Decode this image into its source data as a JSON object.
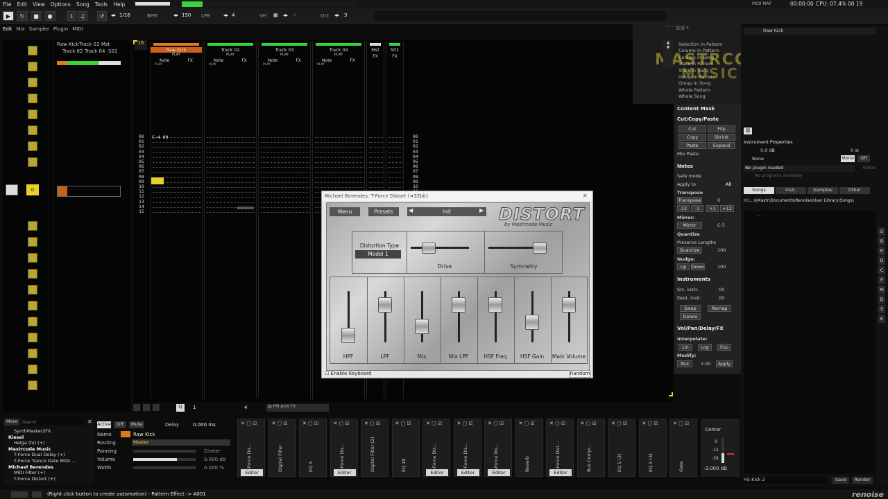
{
  "menu": [
    "File",
    "Edit",
    "View",
    "Options",
    "Song",
    "Tools",
    "Help"
  ],
  "topbar": {
    "midi_map": "MIDI MAP",
    "time": "00:00:00",
    "cpu": "CPU: 07.4%",
    "clock": "00 19"
  },
  "transport": {
    "step": "1/16",
    "bpm_label": "BPM",
    "bpm": "150",
    "lpb_label": "LPB",
    "lpb": "4",
    "vel_label": "Vel",
    "vel": "--",
    "oct_label": "Oct",
    "oct": "3"
  },
  "view_tabs": [
    "Edit",
    "Mix",
    "Sampler",
    "Plugin",
    "MIDI"
  ],
  "pattern_seq": {
    "current": "16"
  },
  "matrix_tracks": [
    "Raw Kick",
    "Track 03",
    "Mst",
    "Track 02",
    "Track 04",
    "S01"
  ],
  "tracks": [
    {
      "name": "Raw Kick",
      "play": "PLAY",
      "cols": [
        "Note",
        "FX"
      ],
      "sub": "PLAY"
    },
    {
      "name": "Track 02",
      "play": "PLAY",
      "cols": [
        "Note",
        "FX"
      ],
      "sub": "PLAY"
    },
    {
      "name": "Track 03",
      "play": "PLAY",
      "cols": [
        "Note",
        "FX"
      ],
      "sub": "PLAY"
    },
    {
      "name": "Track 04",
      "play": "PLAY",
      "cols": [
        "Note",
        "FX"
      ],
      "sub": "PLAY"
    },
    {
      "name": "Mst",
      "play": "",
      "cols": [
        "FX"
      ],
      "sub": ""
    },
    {
      "name": "S01",
      "play": "",
      "cols": [
        "FX"
      ],
      "sub": ""
    }
  ],
  "pattern": {
    "first_note": "C-4 00",
    "rows": [
      "00",
      "01",
      "02",
      "03",
      "04",
      "05",
      "06",
      "07",
      "08",
      "09",
      "10",
      "11",
      "12",
      "13",
      "14",
      "15"
    ],
    "row_lines_right": [
      "00",
      "01",
      "02",
      "03",
      "04",
      "05",
      "06",
      "07",
      "08",
      "09",
      "10",
      "11",
      "12"
    ]
  },
  "plugin_window": {
    "title": "Michael Berendes: T-Force Distort (➔32bit)",
    "menu": "Menu",
    "presets": "Presets",
    "preset": "Init",
    "logo": "DISTORT",
    "logo_sub": "by Mastrcode Music",
    "dist_type_label": "Distortion Type",
    "dist_type": "Model 1",
    "drive": "Drive",
    "symmetry": "Symmetry",
    "faders": [
      "HPF",
      "LPF",
      "Mix",
      "Mix LPF",
      "HSF Freq",
      "HSF Gain",
      "Main Volume"
    ],
    "enable_keyboard": "Enable Keyboard",
    "random": "Random"
  },
  "selection_menu": [
    "Selection in Pattern",
    "Column in Pattern",
    "Column in Song",
    "Track in Pattern",
    "Track in Song",
    "Group in Pattern",
    "Group in Song",
    "Whole Pattern",
    "Whole Song"
  ],
  "watermark": {
    "line1": "MASTRCODE",
    "line2": "MUSIC"
  },
  "right_panel": {
    "content_mask": "Content Mask",
    "cut_copy_paste": "Cut/Copy/Paste",
    "ccp_buttons": [
      "Cut",
      "Flip",
      "Copy",
      "Shrink",
      "Paste",
      "Expand"
    ],
    "mix_paste": "Mix-Paste",
    "notes": "Notes",
    "safe_mode": "Safe mode",
    "apply_to": "Apply to",
    "apply_val": "All",
    "transpose": "Transpose",
    "transpose_btn": "Transpose",
    "transpose_val": "0",
    "semis": [
      "-12",
      "-1",
      "+1",
      "+12"
    ],
    "mirror": "Mirror:",
    "mirror_btn": "Mirror",
    "mirror_val": "C-5",
    "quantize": "Quantize",
    "preserve": "Preserve Lengths",
    "quantize_btn": "Quantize",
    "quantize_val": "100",
    "nudge": "Nudge:",
    "up": "Up",
    "down": "Down",
    "nudge_val": "100",
    "instruments": "Instruments",
    "src": "Src. instr.",
    "src_val": "00",
    "dest": "Dest. instr.",
    "dest_val": "00",
    "swap": "Swap",
    "remap": "Remap",
    "delete": "Delete",
    "vpdf": "Vol/Pan/Delay/FX",
    "interpolate": "Interpolate:",
    "lin": "Lin",
    "log": "Log",
    "exp": "Exp",
    "modify": "Modify:",
    "mul": "Mul",
    "mod_val": "2.00",
    "apply": "Apply"
  },
  "instrument_panel": {
    "selected": "Raw Kick",
    "props": "Instrument Properties",
    "vol": "0.0 dB",
    "pitch": "0 st",
    "none": "None",
    "mono": "Mono",
    "off": "Off",
    "no_plugin": "No plugin loaded",
    "editor": "Editor",
    "no_programs": "No programs available",
    "tabs": [
      "Songs",
      "Instr.",
      "Samples",
      "Other"
    ],
    "path": "H:\\...s\\Mastr\\Documents\\Renoise\\User Library\\Songs\\",
    "parent": "..",
    "save_name": "HS Kick 2",
    "save": "Save",
    "render": "Render",
    "side_letters": [
      "S",
      "B",
      "R",
      "D",
      "C",
      "F",
      "M",
      "D",
      "S",
      "K"
    ]
  },
  "bottom_toolbar": {
    "q_val": "1",
    "oct_val": "4"
  },
  "device_browser": {
    "more": "More",
    "search_placeholder": "Search",
    "items": [
      {
        "t": "SynthMaster2FX",
        "level": 1
      },
      {
        "t": "Kiesel",
        "level": 0
      },
      {
        "t": "Helga (fx) (+)",
        "level": 1
      },
      {
        "t": "Mastrcode Music",
        "level": 0
      },
      {
        "t": "T-Force Dual Delay (+)",
        "level": 1
      },
      {
        "t": "T-Force Trance Gate MIDI ...",
        "level": 1
      },
      {
        "t": "Michael Berendes",
        "level": 0
      },
      {
        "t": "MIDI Filter (+)",
        "level": 1
      },
      {
        "t": "T-Force Distort (+)",
        "level": 1
      }
    ]
  },
  "track_props": {
    "active": "Active",
    "off": "Off",
    "mute": "Mute",
    "delay_label": "Delay",
    "delay": "0.000 ms",
    "name_label": "Name",
    "name": "Raw Kick",
    "routing_label": "Routing",
    "routing": "Master",
    "panning_label": "Panning",
    "panning": "Center",
    "volume_label": "Volume",
    "volume": "0.000 dB",
    "width_label": "Width",
    "width": "0.000 %"
  },
  "devices": [
    {
      "name": "T-Force Dis...",
      "editor": "Editor"
    },
    {
      "name": "Digital Filter",
      "editor": ""
    },
    {
      "name": "EQ 5",
      "editor": ""
    },
    {
      "name": "T-Force Dis...",
      "editor": "Editor"
    },
    {
      "name": "Digital Filter (2)",
      "editor": ""
    },
    {
      "name": "EQ 10",
      "editor": ""
    },
    {
      "name": "T-Force Dis...",
      "editor": "Editor"
    },
    {
      "name": "T-Force Dis...",
      "editor": "Editor"
    },
    {
      "name": "T-Force Dis...",
      "editor": "Editor"
    },
    {
      "name": "Reverb",
      "editor": ""
    },
    {
      "name": "T-Force Dist...",
      "editor": "Editor"
    },
    {
      "name": "Bus Compr...",
      "editor": ""
    },
    {
      "name": "EQ 5 (2)",
      "editor": ""
    },
    {
      "name": "EQ 5 (3)",
      "editor": ""
    },
    {
      "name": "Gate",
      "editor": ""
    }
  ],
  "master": {
    "center": "Center",
    "scale": [
      "0",
      "-12",
      "-36"
    ],
    "db": "-3.000 dB"
  },
  "status": {
    "message": "(Right click button to create automation) - Pattern Effect -> A001",
    "logo": "renoise"
  }
}
